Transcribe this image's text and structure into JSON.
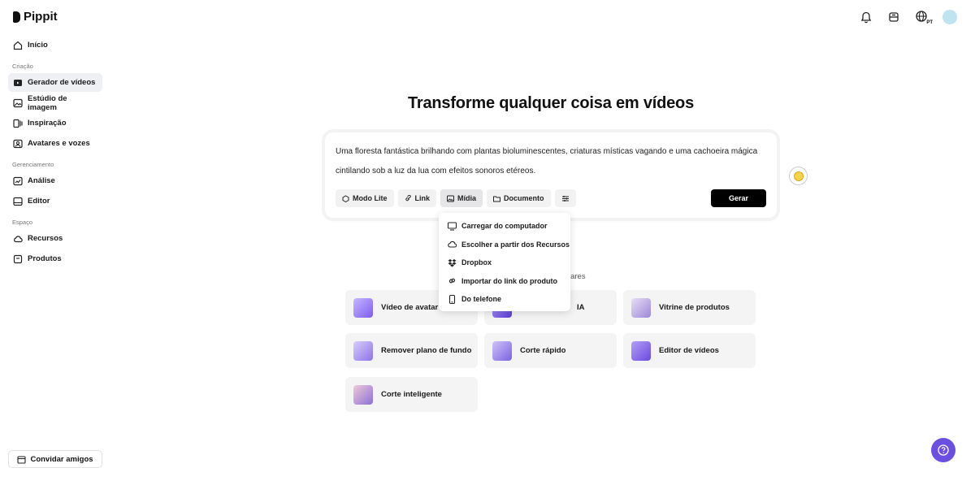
{
  "app": {
    "name": "Pippit"
  },
  "topbar": {
    "language_badge": "PT"
  },
  "sidebar": {
    "home_label": "Início",
    "sections": [
      {
        "title": "Criação",
        "items": [
          {
            "label": "Gerador de vídeos",
            "icon": "video-generator-icon",
            "active": true
          },
          {
            "label": "Estúdio de imagem",
            "icon": "image-studio-icon"
          },
          {
            "label": "Inspiração",
            "icon": "inspiration-icon"
          },
          {
            "label": "Avatares e vozes",
            "icon": "avatar-voice-icon"
          }
        ]
      },
      {
        "title": "Gerenciamento",
        "items": [
          {
            "label": "Análise",
            "icon": "analytics-icon"
          },
          {
            "label": "Editor",
            "icon": "editor-icon"
          }
        ]
      },
      {
        "title": "Espaço",
        "items": [
          {
            "label": "Recursos",
            "icon": "cloud-icon"
          },
          {
            "label": "Produtos",
            "icon": "products-icon"
          }
        ]
      }
    ],
    "invite_label": "Convidar amigos"
  },
  "main": {
    "headline": "Transforme qualquer coisa em vídeos",
    "prompt_text": "Uma floresta fantástica brilhando com plantas bioluminescentes, criaturas místicas vagando e uma cachoeira mágica cintilando sob a luz da lua com efeitos sonoros etéreos.",
    "toolbar": {
      "lite_mode": "Modo Lite",
      "link": "Link",
      "media": "Mídia",
      "document": "Documento",
      "generate": "Gerar"
    },
    "popular_label": "lares",
    "cards": [
      {
        "label": "Vídeo de avatar"
      },
      {
        "label": "IA"
      },
      {
        "label": "Vitrine de produtos"
      },
      {
        "label": "Remover plano de fundo"
      },
      {
        "label": "Corte rápido"
      },
      {
        "label": "Editor de vídeos"
      },
      {
        "label": "Corte inteligente"
      }
    ]
  },
  "media_menu": {
    "items": [
      {
        "label": "Carregar do computador",
        "icon": "monitor-icon"
      },
      {
        "label": "Escolher a partir dos Recursos",
        "icon": "cloud-icon"
      },
      {
        "label": "Dropbox",
        "icon": "dropbox-icon"
      },
      {
        "label": "Importar do link do produto",
        "icon": "link-icon"
      },
      {
        "label": "Do telefone",
        "icon": "phone-icon"
      }
    ]
  },
  "colors": {
    "accent": "#6b4fe0",
    "primary_button": "#000000",
    "active_nav": "#eef0f4",
    "card_bg": "#f4f4f5"
  }
}
